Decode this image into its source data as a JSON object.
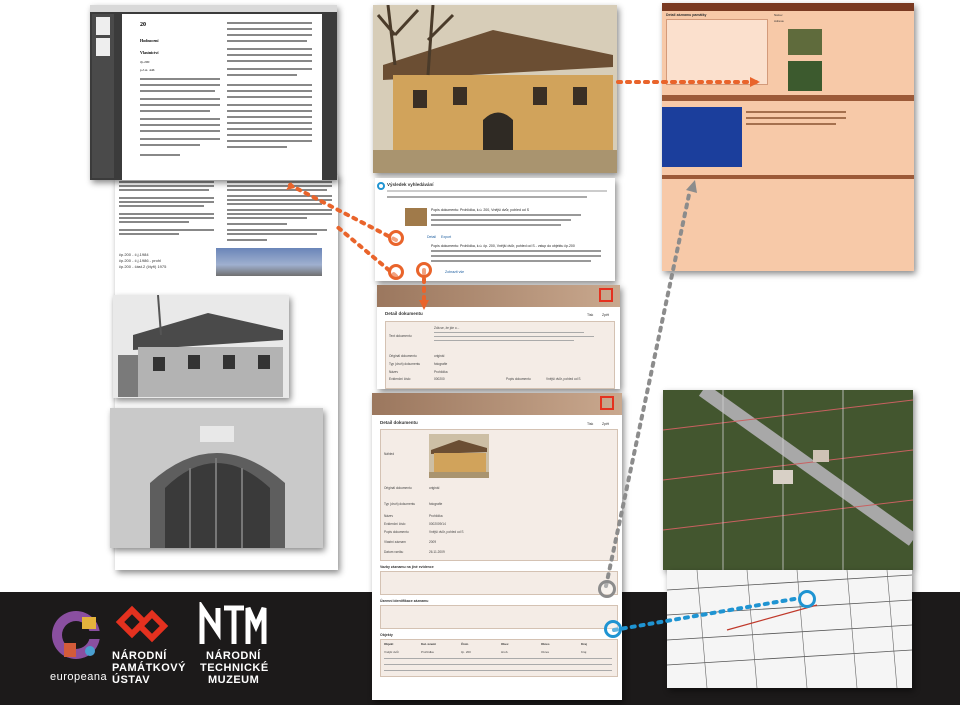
{
  "colors": {
    "dark_band": "#1c1a1a",
    "orange": "#e9642b",
    "blue": "#1f94d2",
    "grey_marker": "#8c8c8c",
    "npu_red": "#e4311f",
    "doc_header": "#b7957b",
    "salmon_panel": "#f7c9a8",
    "table_blue": "#1b3e9c"
  },
  "document": {
    "heading": "20",
    "subheading": "Hodnocení",
    "line1": "Vlastnictví",
    "line2": "čp.200",
    "line3": "p.č.st. 446",
    "footer_lines": [
      "čp.200 - č.j.1984",
      "čp.200 - č.j.1986 - prohl",
      "čp.200 - část.2 (čtyři) 1975"
    ]
  },
  "record_list": {
    "title": "Výsledek vyhledávání",
    "entry1_title": "Popis dokumentu: Prohlídka, k.ú. 200, Vnější dvůr, pohled od S",
    "entry2_title": "Popis dokumentu: Prohlídka, k.ú. čp. 200, Vnější dvůr, pohled od S - vstup do objektu čp.200",
    "action_detail": "Detail",
    "action_export": "Export",
    "action_all": "Zobrazit vše"
  },
  "detail_top": {
    "header_title": "Detail dokumentu",
    "action_back": "Zpět",
    "action_print": "Tisk",
    "row_labels": [
      "Text dokumentu",
      "Originál dokumentu",
      "Typ (druh) dokumentu",
      "Název",
      "Evidenční číslo",
      "Popis dokumentu"
    ],
    "row_values": [
      "Zdá se, že jde o...",
      "originál",
      "fotografie",
      "Prohlídka",
      "000200",
      "Vnější dvůr, pohled od S"
    ]
  },
  "detail_main": {
    "header_title": "Detail dokumentu",
    "action_back": "Zpět",
    "action_print": "Tisk",
    "row_labels": [
      "Náhled",
      "Originál dokumentu",
      "Typ (druh) dokumentu",
      "Název",
      "Evidenční číslo",
      "Popis dokumentu",
      "Vlastní záznam",
      "Datum vzniku"
    ],
    "row_values": [
      "",
      "originál",
      "fotografie",
      "Prohlídka",
      "0002009/14",
      "Vnější dvůr, pohled od S",
      "2009",
      "26.11.2009"
    ],
    "section1": "Vazby záznamu na jiné evidence",
    "section2": "Územní identifikace záznamu",
    "section3": "Objekty",
    "table_headers": [
      "Objekt",
      "Kat. území",
      "Číslo",
      "Obec",
      "Okres",
      "Kraj"
    ],
    "table_row": [
      "Vnější dvůr",
      "Prohlídka",
      "čp. 200",
      "Hrob.",
      "Okres",
      "Kraj"
    ]
  },
  "record_sheet": {
    "title": "Detail záznamu památky",
    "field1": "Název",
    "field2": "Adresa"
  },
  "logos": {
    "europeana": "europeana",
    "npu_line1": "NÁRODNÍ",
    "npu_line2": "PAMÁTKOVÝ",
    "npu_line3": "ÚSTAV",
    "ntm_line1": "NÁRODNÍ",
    "ntm_line2": "TECHNICKÉ",
    "ntm_line3": "MUZEUM"
  },
  "photos": {
    "photo1": "house-color-photo",
    "photo2": "house-bw-photo",
    "photo3": "gate-bw-photo"
  }
}
